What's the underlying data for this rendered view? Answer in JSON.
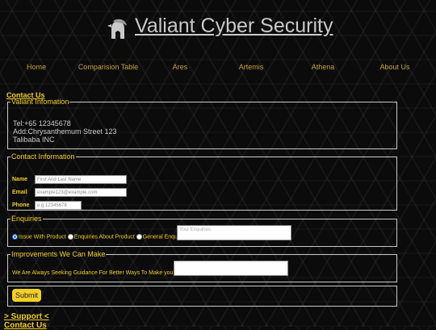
{
  "header": {
    "brand": "Valiant Cyber Security",
    "logo_icon": "spartan-helmet-icon"
  },
  "nav": {
    "items": [
      "Home",
      "Comparision Table",
      "Ares",
      "Artemis",
      "Athena",
      "About Us"
    ]
  },
  "contact": {
    "title": "Contact Us",
    "valiant_info": {
      "legend": "Valiant Infomation",
      "tel": "Tel:+65 12345678",
      "address": "Add:Chrysanthemum Street 123",
      "company": "Talibaba INC"
    },
    "contact_info": {
      "legend": "Contact Information",
      "name_label": "Name",
      "name_placeholder": "First And Last Name",
      "email_label": "Email",
      "email_placeholder": "example123@example.com",
      "phone_label": "Phone",
      "phone_placeholder": "e.g 12345678"
    },
    "enquiries": {
      "legend": "Enquiries",
      "options": [
        "Issue With Product",
        "Enquiries About Product",
        "General Enquiries"
      ],
      "selected": "Issue With Product",
      "textarea_placeholder": "Your Enquiries:"
    },
    "improvements": {
      "legend": "Improvements We Can Make",
      "text": "We Are Always Seeking Guidance For Better Ways To Make your day."
    },
    "submit_label": "Submit"
  },
  "footer": {
    "support_link": "> Support <",
    "contact_link": "Contact Us"
  },
  "colors": {
    "accent": "#f2cf26",
    "nav": "#c9a13b",
    "text_light": "#c9c9c9",
    "background": "#0b0b0b"
  }
}
